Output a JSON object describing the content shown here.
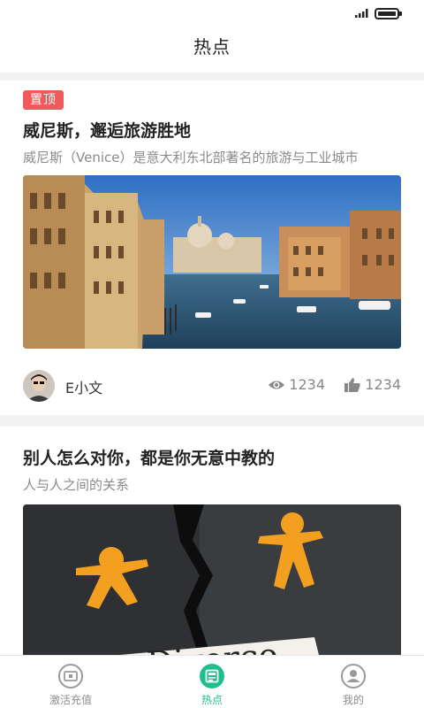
{
  "header": {
    "title": "热点"
  },
  "feed": [
    {
      "badge": "置顶",
      "title": "威尼斯，邂逅旅游胜地",
      "subtitle": "威尼斯（Venice）是意大利东北部著名的旅游与工业城市",
      "author": "E小文",
      "views": "1234",
      "likes": "1234"
    },
    {
      "title": "别人怎么对你，都是你无意中教的",
      "subtitle": "人与人之间的关系",
      "image_text": "Divorce"
    }
  ],
  "nav": {
    "items": [
      {
        "label": "激活充值",
        "icon": "wallet-icon",
        "active": false
      },
      {
        "label": "热点",
        "icon": "news-icon",
        "active": true
      },
      {
        "label": "我的",
        "icon": "profile-icon",
        "active": false
      }
    ],
    "active_color": "#1fbe8f"
  },
  "colors": {
    "badge": "#ef5b5b",
    "accent": "#1fbe8f"
  }
}
